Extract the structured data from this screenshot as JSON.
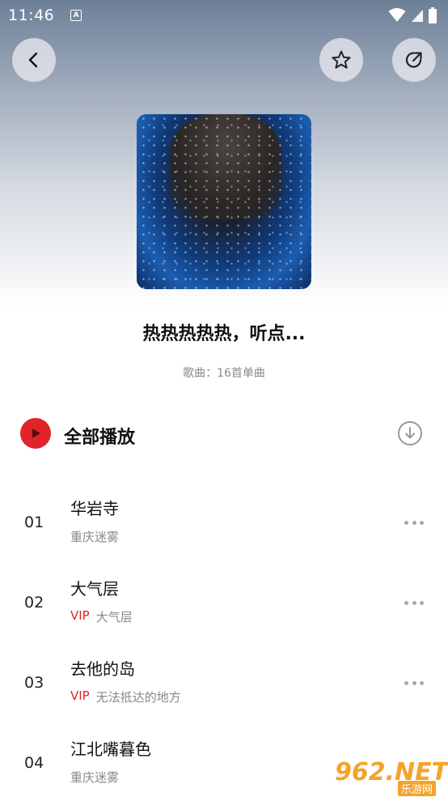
{
  "status_bar": {
    "time": "11:46",
    "notification_icon": "A"
  },
  "header": {
    "back_icon": "chevron-left-icon",
    "favorite_icon": "star-icon",
    "share_icon": "share-icon"
  },
  "playlist": {
    "title": "热热热热热，听点...",
    "subtitle": "歌曲：16首单曲"
  },
  "play_all": {
    "label": "全部播放",
    "accent_color": "#e0252a"
  },
  "songs": [
    {
      "num": "01",
      "title": "华岩寺",
      "vip": "",
      "artist": "重庆迷雾"
    },
    {
      "num": "02",
      "title": "大气层",
      "vip": "VIP",
      "artist": "大气层"
    },
    {
      "num": "03",
      "title": "去他的岛",
      "vip": "VIP",
      "artist": "无法抵达的地方"
    },
    {
      "num": "04",
      "title": "江北嘴暮色",
      "vip": "",
      "artist": "重庆迷雾"
    }
  ],
  "watermark": {
    "main": "962.NET",
    "sub": "乐游网"
  }
}
